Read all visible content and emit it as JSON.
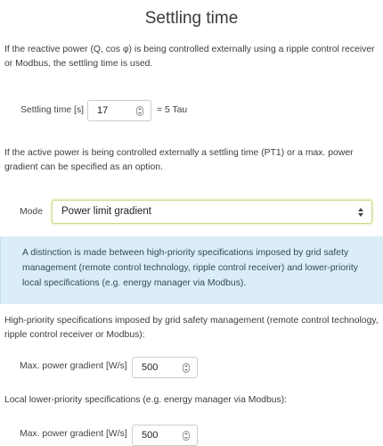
{
  "title": "Settling time",
  "intro_text": "If the reactive power (Q, cos φ) is being controlled externally using a ripple control receiver or Modbus, the settling time is used.",
  "settling": {
    "label": "Settling time [s]",
    "value": "17",
    "suffix": "= 5 Tau"
  },
  "active_text": "If the active power is being controlled externally a settling time (PT1) or a max. power gradient can be specified as an option.",
  "mode": {
    "label": "Mode",
    "selected": "Power limit gradient"
  },
  "info_text": "A distinction is made between high-priority specifications imposed by grid safety management (remote control technology, ripple control receiver) and lower-priority local specifications (e.g. energy manager via Modbus).",
  "high_priority": {
    "text": "High-priority specifications imposed by grid safety management (remote control technology, ripple control receiver or Modbus):",
    "label": "Max. power gradient [W/s]",
    "value": "500"
  },
  "local_priority": {
    "text": "Local lower-priority specifications (e.g. energy manager via Modbus):",
    "label": "Max. power gradient [W/s]",
    "value": "500"
  },
  "colors": {
    "info_background": "#dbedf6",
    "select_focus_border": "#c9d98a"
  }
}
